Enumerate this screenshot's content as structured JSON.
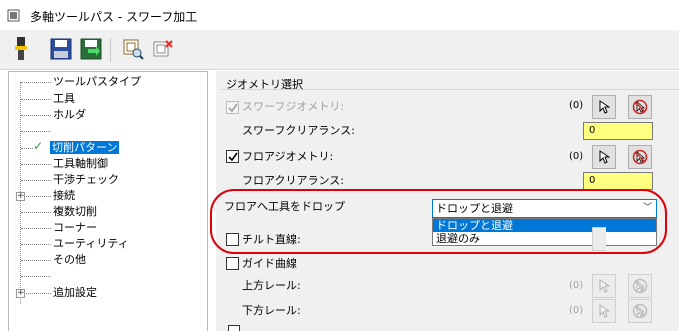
{
  "window": {
    "title": "多軸ツールパス - スワーフ加工"
  },
  "toolbar": {
    "buttons": [
      "tool-icon",
      "save-icon",
      "export-save-icon",
      "preview-icon",
      "delete-icon"
    ]
  },
  "tree": {
    "items": [
      {
        "label": "ツールパスタイプ"
      },
      {
        "label": "工具"
      },
      {
        "label": "ホルダ"
      },
      {
        "label": "切削パターン",
        "selected": true
      },
      {
        "label": "工具軸制御"
      },
      {
        "label": "干渉チェック"
      },
      {
        "label": "接続"
      },
      {
        "label": "複数切削"
      },
      {
        "label": "コーナー"
      },
      {
        "label": "ユーティリティ"
      },
      {
        "label": "その他"
      },
      {
        "label": "追加設定"
      }
    ]
  },
  "geometry": {
    "group_title": "ジオメトリ選択",
    "swarf_geometry": {
      "label": "スワーフジオメトリ:",
      "checked": true,
      "enabled": false,
      "count": "(0)"
    },
    "swarf_clearance": {
      "label": "スワーフクリアランス:",
      "value": "0"
    },
    "floor_geometry": {
      "label": "フロアジオメトリ:",
      "checked": true,
      "enabled": true,
      "count": "(0)"
    },
    "floor_clearance": {
      "label": "フロアクリアランス:",
      "value": "0"
    },
    "drop_tool": {
      "label": "フロアへ工具をドロップ",
      "selected": "ドロップと退避",
      "options": [
        "ドロップと退避",
        "退避のみ"
      ]
    },
    "tilt_line": {
      "label": "チルト直線:"
    },
    "guide_curve": {
      "label": "ガイド曲線"
    },
    "upper_rail": {
      "label": "上方レール:",
      "count": "(0)"
    },
    "lower_rail": {
      "label": "下方レール:",
      "count": "(0)"
    }
  },
  "colors": {
    "accent": "#0078d7",
    "highlight_ring": "#e0000b",
    "input_bg": "#ffff80"
  }
}
